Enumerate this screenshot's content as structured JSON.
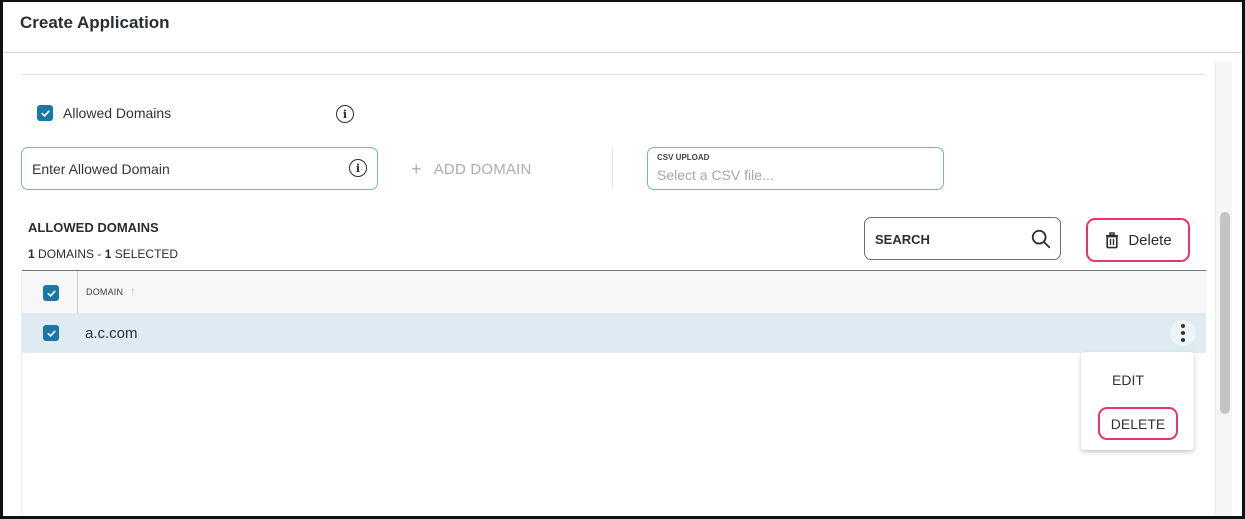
{
  "window": {
    "title": "Create Application"
  },
  "allowed_domains_toggle": {
    "label": "Allowed Domains",
    "checked": true,
    "info_icon": "info-icon"
  },
  "domain_input": {
    "placeholder": "Enter Allowed Domain",
    "value": "",
    "info_icon": "info-icon"
  },
  "add_domain": {
    "icon": "plus-icon",
    "label": "ADD DOMAIN"
  },
  "csv_upload": {
    "label": "CSV UPLOAD",
    "placeholder": "Select a CSV file..."
  },
  "list_header": {
    "title": "ALLOWED DOMAINS",
    "domain_count": "1",
    "domain_count_suffix": " DOMAINS - ",
    "selected_count": "1",
    "selected_suffix": " SELECTED"
  },
  "search": {
    "label": "SEARCH",
    "icon": "search-icon"
  },
  "delete_button": {
    "icon": "trash-icon",
    "label": "Delete"
  },
  "table": {
    "select_all_checked": true,
    "columns": [
      {
        "label": "DOMAIN",
        "sort": "ascending",
        "sort_icon": "arrow-up-icon"
      }
    ],
    "rows": [
      {
        "domain": "a.c.com",
        "checked": true,
        "actions_icon": "kebab-menu-icon"
      }
    ]
  },
  "row_menu": {
    "items": [
      {
        "label": "EDIT"
      },
      {
        "label": "DELETE"
      }
    ]
  },
  "colors": {
    "accent": "#1a77a6",
    "input_border": "#6fbfa3",
    "highlight": "#e8346a",
    "selected_row": "#deebf2"
  }
}
